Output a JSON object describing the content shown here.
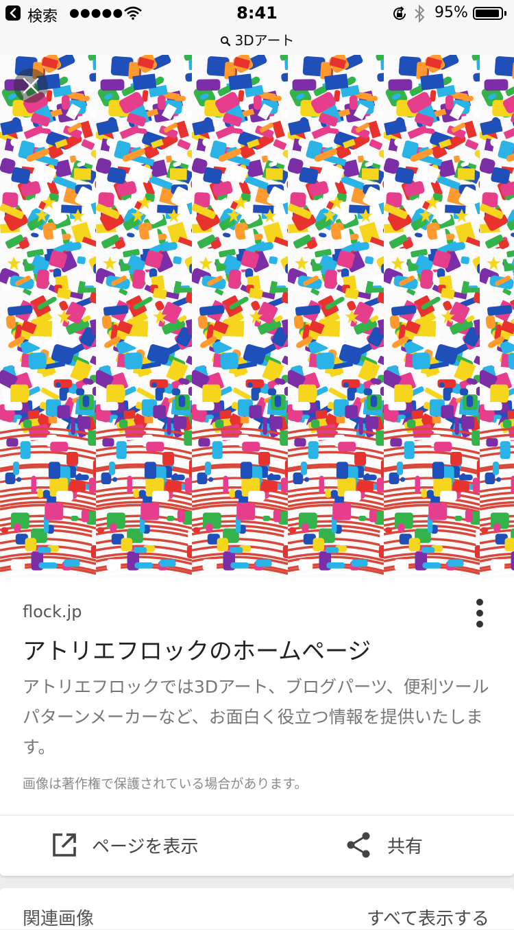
{
  "status_bar": {
    "back_label": "検索",
    "signal": "●●●●●",
    "time": "8:41",
    "battery_text": "95%",
    "battery_level": 0.95
  },
  "url_bar": {
    "query": "3Dアート"
  },
  "image": {
    "description_colors": [
      "#e8322e",
      "#2ab3e6",
      "#33b34a",
      "#7b2ea6",
      "#f5d61c",
      "#e63d8c"
    ]
  },
  "result": {
    "domain": "flock.jp",
    "title": "アトリエフロックのホームページ",
    "description": "アトリエフロックでは3Dアート、ブログパーツ、便利ツールパターンメーカーなど、お面白く役立つ情報を提供いたします。",
    "copyright": "画像は著作権で保護されている場合があります。",
    "view_page_label": "ページを表示",
    "share_label": "共有"
  },
  "related": {
    "heading": "関連画像",
    "see_all": "すべて表示する"
  }
}
